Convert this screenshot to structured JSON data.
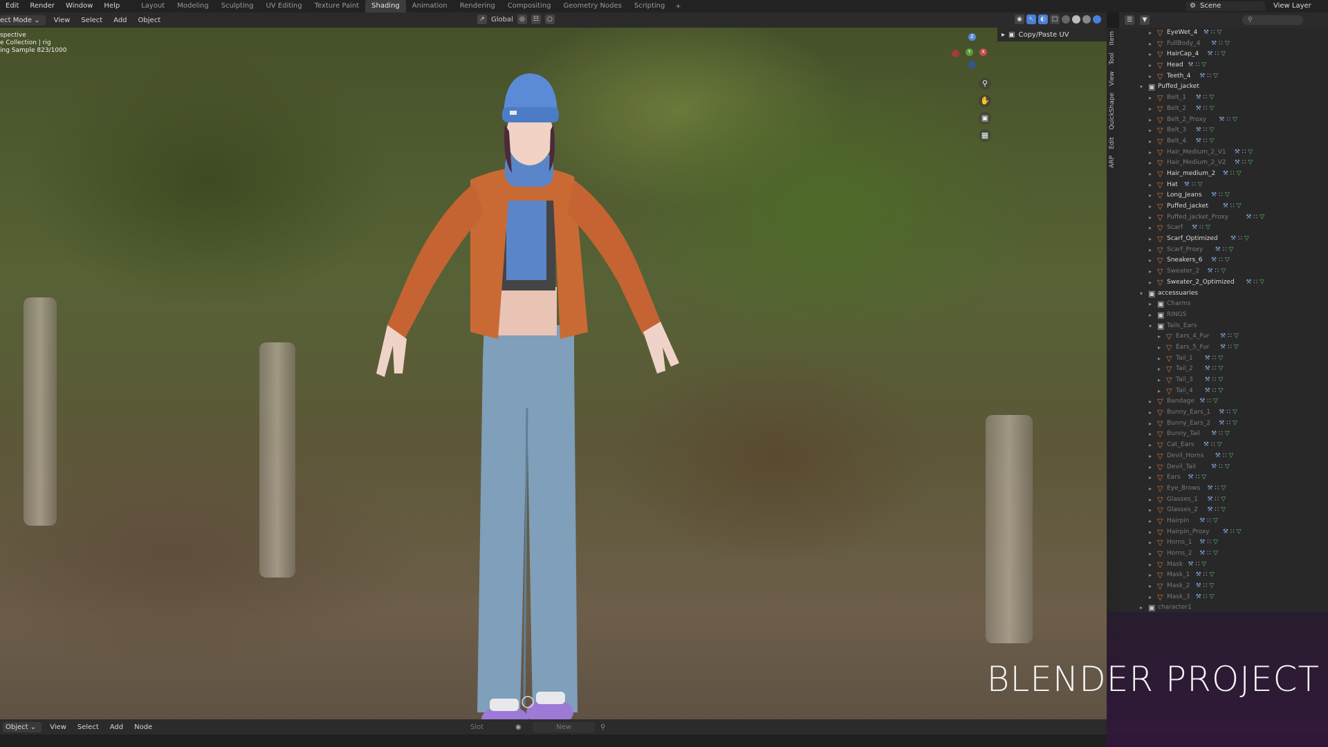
{
  "top_menu": {
    "items": [
      "Edit",
      "Render",
      "Window",
      "Help"
    ],
    "workspaces": [
      "Layout",
      "Modeling",
      "Sculpting",
      "UV Editing",
      "Texture Paint",
      "Shading",
      "Animation",
      "Rendering",
      "Compositing",
      "Geometry Nodes",
      "Scripting"
    ],
    "active_workspace": "Shading",
    "add_tab": "+",
    "scene": "Scene",
    "view_layer": "View Layer"
  },
  "viewport_header": {
    "mode": "ect Mode",
    "menus": [
      "View",
      "Select",
      "Add",
      "Object"
    ],
    "orientation": "Global"
  },
  "viewport": {
    "overlay_lines": [
      "spective",
      "e Collection | rig",
      "ing Sample 823/1000"
    ],
    "npanel_label": "Copy/Paste UV",
    "side_tabs": [
      "Item",
      "Tool",
      "View",
      "QuickShape",
      "Edit",
      "ARP"
    ],
    "gizmo": {
      "z": "Z",
      "y": "Y",
      "x": "X"
    }
  },
  "outliner": {
    "rows": [
      {
        "name": "EyeWet_4",
        "depth": 2,
        "type": "mesh",
        "expand": "closed",
        "dim": false
      },
      {
        "name": "FullBody_4",
        "depth": 2,
        "type": "mesh",
        "expand": "closed",
        "dim": true
      },
      {
        "name": "HairCap_4",
        "depth": 2,
        "type": "mesh",
        "expand": "closed",
        "dim": false
      },
      {
        "name": "Head",
        "depth": 2,
        "type": "mesh",
        "expand": "closed",
        "dim": false
      },
      {
        "name": "Teeth_4",
        "depth": 2,
        "type": "mesh",
        "expand": "closed",
        "dim": false
      },
      {
        "name": "Puffed_jacket",
        "depth": 1,
        "type": "collection",
        "expand": "open",
        "dim": false
      },
      {
        "name": "Belt_1",
        "depth": 2,
        "type": "mesh",
        "expand": "closed",
        "dim": true
      },
      {
        "name": "Belt_2",
        "depth": 2,
        "type": "mesh",
        "expand": "closed",
        "dim": true
      },
      {
        "name": "Belt_2_Proxy",
        "depth": 2,
        "type": "mesh",
        "expand": "closed",
        "dim": true
      },
      {
        "name": "Belt_3",
        "depth": 2,
        "type": "mesh",
        "expand": "closed",
        "dim": true
      },
      {
        "name": "Belt_4",
        "depth": 2,
        "type": "mesh",
        "expand": "closed",
        "dim": true
      },
      {
        "name": "Hair_Medium_2_V1",
        "depth": 2,
        "type": "mesh",
        "expand": "closed",
        "dim": true
      },
      {
        "name": "Hair_Medium_2_V2",
        "depth": 2,
        "type": "mesh",
        "expand": "closed",
        "dim": true
      },
      {
        "name": "Hair_medium_2",
        "depth": 2,
        "type": "mesh",
        "expand": "closed",
        "dim": false
      },
      {
        "name": "Hat",
        "depth": 2,
        "type": "mesh",
        "expand": "closed",
        "dim": false
      },
      {
        "name": "Long_Jeans",
        "depth": 2,
        "type": "mesh",
        "expand": "closed",
        "dim": false
      },
      {
        "name": "Puffed_jacket",
        "depth": 2,
        "type": "mesh",
        "expand": "closed",
        "dim": false
      },
      {
        "name": "Puffed_jacket_Proxy",
        "depth": 2,
        "type": "mesh",
        "expand": "closed",
        "dim": true
      },
      {
        "name": "Scarf",
        "depth": 2,
        "type": "mesh",
        "expand": "closed",
        "dim": true
      },
      {
        "name": "Scarf_Optimized",
        "depth": 2,
        "type": "mesh",
        "expand": "closed",
        "dim": false
      },
      {
        "name": "Scarf_Proxy",
        "depth": 2,
        "type": "mesh",
        "expand": "closed",
        "dim": true
      },
      {
        "name": "Sneakers_6",
        "depth": 2,
        "type": "mesh",
        "expand": "closed",
        "dim": false
      },
      {
        "name": "Sweater_2",
        "depth": 2,
        "type": "mesh",
        "expand": "closed",
        "dim": true
      },
      {
        "name": "Sweater_2_Optimized",
        "depth": 2,
        "type": "mesh",
        "expand": "closed",
        "dim": false
      },
      {
        "name": "accessuaries",
        "depth": 1,
        "type": "collection",
        "expand": "open",
        "dim": false
      },
      {
        "name": "Charms",
        "depth": 2,
        "type": "collection",
        "expand": "closed",
        "dim": true
      },
      {
        "name": "RINGS",
        "depth": 2,
        "type": "collection",
        "expand": "closed",
        "dim": true
      },
      {
        "name": "Tails_Ears",
        "depth": 2,
        "type": "collection",
        "expand": "open",
        "dim": true
      },
      {
        "name": "Ears_4_Fur",
        "depth": 3,
        "type": "mesh",
        "expand": "closed",
        "dim": true
      },
      {
        "name": "Ears_5_Fur",
        "depth": 3,
        "type": "mesh",
        "expand": "closed",
        "dim": true
      },
      {
        "name": "Tail_1",
        "depth": 3,
        "type": "mesh",
        "expand": "closed",
        "dim": true
      },
      {
        "name": "Tail_2",
        "depth": 3,
        "type": "mesh",
        "expand": "closed",
        "dim": true
      },
      {
        "name": "Tail_3",
        "depth": 3,
        "type": "mesh",
        "expand": "closed",
        "dim": true
      },
      {
        "name": "Tail_4",
        "depth": 3,
        "type": "mesh",
        "expand": "closed",
        "dim": true
      },
      {
        "name": "Bandage",
        "depth": 2,
        "type": "mesh",
        "expand": "closed",
        "dim": true
      },
      {
        "name": "Bunny_Ears_1",
        "depth": 2,
        "type": "mesh",
        "expand": "closed",
        "dim": true
      },
      {
        "name": "Bunny_Ears_2",
        "depth": 2,
        "type": "mesh",
        "expand": "closed",
        "dim": true
      },
      {
        "name": "Bunny_Tail",
        "depth": 2,
        "type": "mesh",
        "expand": "closed",
        "dim": true
      },
      {
        "name": "Cat_Ears",
        "depth": 2,
        "type": "mesh",
        "expand": "closed",
        "dim": true
      },
      {
        "name": "Devil_Horns",
        "depth": 2,
        "type": "mesh",
        "expand": "closed",
        "dim": true
      },
      {
        "name": "Devil_Tail",
        "depth": 2,
        "type": "mesh",
        "expand": "closed",
        "dim": true
      },
      {
        "name": "Ears",
        "depth": 2,
        "type": "mesh",
        "expand": "closed",
        "dim": true
      },
      {
        "name": "Eye_Brows",
        "depth": 2,
        "type": "mesh",
        "expand": "closed",
        "dim": true
      },
      {
        "name": "Glasses_1",
        "depth": 2,
        "type": "mesh",
        "expand": "closed",
        "dim": true
      },
      {
        "name": "Glasses_2",
        "depth": 2,
        "type": "mesh",
        "expand": "closed",
        "dim": true
      },
      {
        "name": "Hairpin",
        "depth": 2,
        "type": "mesh",
        "expand": "closed",
        "dim": true
      },
      {
        "name": "Hairpin_Proxy",
        "depth": 2,
        "type": "mesh",
        "expand": "closed",
        "dim": true
      },
      {
        "name": "Horns_1",
        "depth": 2,
        "type": "mesh",
        "expand": "closed",
        "dim": true
      },
      {
        "name": "Horns_2",
        "depth": 2,
        "type": "mesh",
        "expand": "closed",
        "dim": true
      },
      {
        "name": "Mask",
        "depth": 2,
        "type": "mesh",
        "expand": "closed",
        "dim": true
      },
      {
        "name": "Mask_1",
        "depth": 2,
        "type": "mesh",
        "expand": "closed",
        "dim": true
      },
      {
        "name": "Mask_2",
        "depth": 2,
        "type": "mesh",
        "expand": "closed",
        "dim": true
      },
      {
        "name": "Mask_3",
        "depth": 2,
        "type": "mesh",
        "expand": "closed",
        "dim": true
      },
      {
        "name": "character1",
        "depth": 1,
        "type": "collection",
        "expand": "closed",
        "dim": true
      }
    ]
  },
  "bottom_header": {
    "mode": "Object",
    "menus": [
      "View",
      "Select",
      "Add",
      "Node"
    ],
    "slot_label": "Slot",
    "new_button": "New"
  },
  "brand": {
    "title": "BLENDER PROJECT"
  },
  "colors": {
    "active_tab": "#3d3d3d",
    "mesh_icon": "#d4783a",
    "modifier_icon": "#7ea6d8",
    "data_icon": "#5fbf78",
    "brand_bg": "#32163c",
    "selection_blue": "#4a7fd9"
  }
}
